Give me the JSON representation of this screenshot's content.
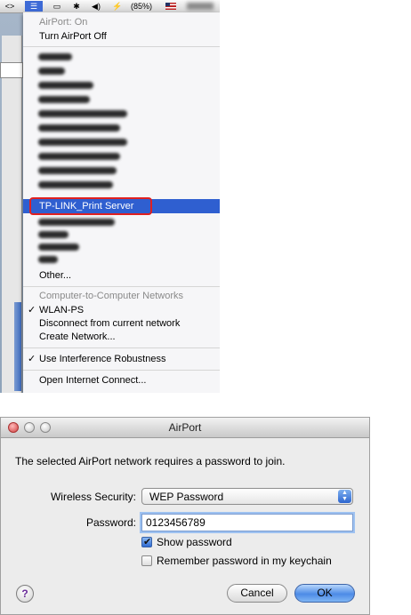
{
  "menubar": {
    "items": [
      "<>",
      "☰",
      "▭",
      "✱",
      "◀)",
      "⚡",
      "(85%)",
      "flag"
    ],
    "battery": "(85%)"
  },
  "menu": {
    "status": "AirPort: On",
    "turn_off": "Turn AirPort Off",
    "highlighted_network": "TP-LINK_Print Server",
    "other": "Other...",
    "c2c_header": "Computer-to-Computer Networks",
    "wlan": "WLAN-PS",
    "disconnect": "Disconnect from current network",
    "create": "Create Network...",
    "interference": "Use Interference Robustness",
    "open_ic": "Open Internet Connect...",
    "check": "✓"
  },
  "dialog": {
    "title": "AirPort",
    "message": "The selected AirPort network requires a password to join.",
    "security_label": "Wireless Security:",
    "security_value": "WEP Password",
    "password_label": "Password:",
    "password_value": "0123456789",
    "show_password": "Show password",
    "remember": "Remember password in my keychain",
    "help": "?",
    "cancel": "Cancel",
    "ok": "OK"
  },
  "colors": {
    "selection": "#2f5fd0",
    "highlight_ring": "#e02020",
    "ok_button": "#4d8be6"
  }
}
